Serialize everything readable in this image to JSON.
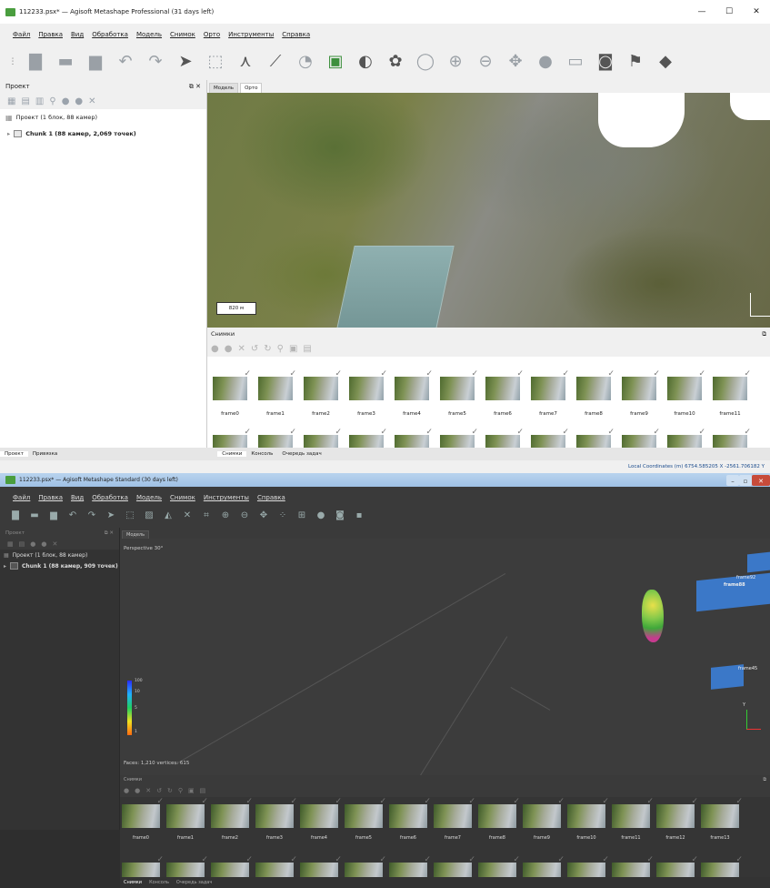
{
  "window1": {
    "title": "112233.psx* — Agisoft Metashape Professional (31 days left)",
    "window_buttons": [
      "—",
      "☐",
      "✕"
    ],
    "menu": [
      "Файл",
      "Правка",
      "Вид",
      "Обработка",
      "Модель",
      "Снимок",
      "Орто",
      "Инструменты",
      "Справка"
    ],
    "workspace": {
      "title": "Проект",
      "project_label": "Проект (1 блок, 88 камер)",
      "chunk_label": "Chunk 1 (88 камер, 2,069 точек)"
    },
    "viewport_tabs": [
      "Модель",
      "Орто"
    ],
    "active_tab": "Орто",
    "scale_bar": "820 м",
    "photos_title": "Снимки",
    "frames_row1": [
      "frame0",
      "frame1",
      "frame2",
      "frame3",
      "frame4",
      "frame5",
      "frame6",
      "frame7",
      "frame8",
      "frame9",
      "frame10",
      "frame11"
    ],
    "bottom_tabs_left": [
      "Проект",
      "Привязка"
    ],
    "bottom_tabs_right": [
      "Снимки",
      "Консоль",
      "Очередь задач"
    ],
    "status": "Local Coordinates (m)  6754.585205 X  -2561.706182 Y"
  },
  "window2": {
    "title": "112233.psx* — Agisoft Metashape Standard (30 days left)",
    "menu": [
      "Файл",
      "Правка",
      "Вид",
      "Обработка",
      "Модель",
      "Снимок",
      "Инструменты",
      "Справка"
    ],
    "workspace": {
      "title": "Проект",
      "project_label": "Проект (1 блок, 88 камер)",
      "chunk_label": "Chunk 1 (88 камер, 909 точек)"
    },
    "viewport_tabs": [
      "Модель"
    ],
    "perspective": "Perspective 30°",
    "faces": "Faces: 1,210 vertices: 615",
    "colorbar_ticks": [
      "100",
      "10",
      "5",
      "1"
    ],
    "camera_labels": [
      "frame92",
      "frame88",
      "frame45"
    ],
    "photos_title": "Снимки",
    "frames_row1": [
      "frame0",
      "frame1",
      "frame2",
      "frame3",
      "frame4",
      "frame5",
      "frame6",
      "frame7",
      "frame8",
      "frame9",
      "frame10",
      "frame11",
      "frame12",
      "frame13"
    ],
    "bottom_tabs": [
      "Снимки",
      "Консоль",
      "Очередь задач"
    ]
  }
}
